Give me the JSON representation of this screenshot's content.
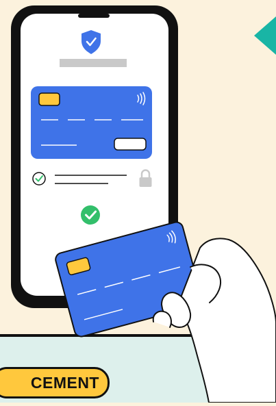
{
  "badge": {
    "label": "CEMENT"
  },
  "colors": {
    "background": "#FCF2DD",
    "lower_panel": "#DDF0EC",
    "card_blue": "#3F73E8",
    "chip_yellow": "#FFC83D",
    "success_green": "#33BF6B",
    "arrow_teal": "#19B5A5",
    "outline": "#111111"
  },
  "icons": [
    "shield-check-icon",
    "contactless-icon",
    "check-circle-icon",
    "lock-icon",
    "success-check-icon",
    "arrow-icon"
  ]
}
